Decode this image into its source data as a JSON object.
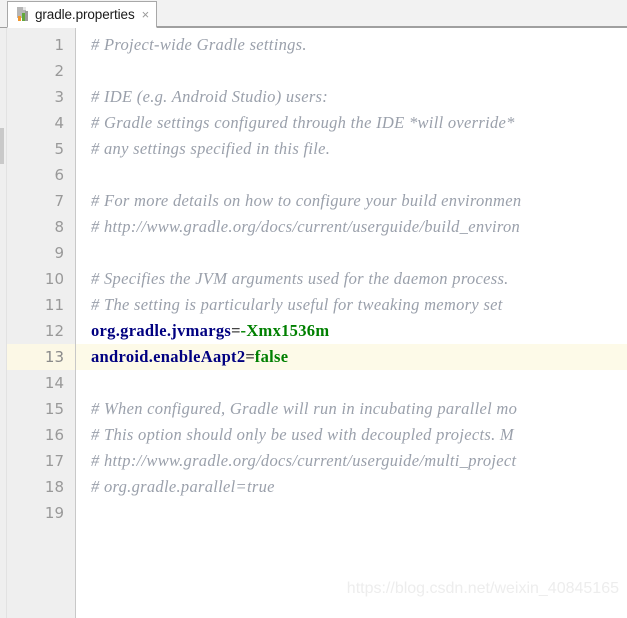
{
  "tabbar": {
    "tabs": [
      {
        "label": "gradle.properties",
        "icon": "gradle-properties-file-icon",
        "close_label": "×",
        "active": true
      }
    ]
  },
  "editor": {
    "file_name": "gradle.properties",
    "active_line": 13,
    "first_line": 1,
    "last_line": 19,
    "colors": {
      "comment": "#9aa0ab",
      "key": "#000080",
      "value": "#008000",
      "equals": "#444444",
      "gutter_bg": "#efefef",
      "gutter_fg": "#999999",
      "active_line_bg": "#fdfae8",
      "active_gutter_bg": "#fcf8e6",
      "editor_bg": "#ffffff"
    },
    "line_numbers": [
      1,
      2,
      3,
      4,
      5,
      6,
      7,
      8,
      9,
      10,
      11,
      12,
      13,
      14,
      15,
      16,
      17,
      18,
      19
    ],
    "lines": [
      {
        "n": 1,
        "type": "comment",
        "text": "# Project-wide Gradle settings."
      },
      {
        "n": 2,
        "type": "blank",
        "text": ""
      },
      {
        "n": 3,
        "type": "comment",
        "text": "# IDE (e.g. Android Studio) users:"
      },
      {
        "n": 4,
        "type": "comment",
        "text": "# Gradle settings configured through the IDE *will override*"
      },
      {
        "n": 5,
        "type": "comment",
        "text": "# any settings specified in this file."
      },
      {
        "n": 6,
        "type": "blank",
        "text": ""
      },
      {
        "n": 7,
        "type": "comment",
        "text": "# For more details on how to configure your build environmen"
      },
      {
        "n": 8,
        "type": "comment",
        "text": "# http://www.gradle.org/docs/current/userguide/build_environ"
      },
      {
        "n": 9,
        "type": "blank",
        "text": ""
      },
      {
        "n": 10,
        "type": "comment",
        "text": "# Specifies the JVM arguments used for the daemon process."
      },
      {
        "n": 11,
        "type": "comment",
        "text": "# The setting is particularly useful for tweaking memory set"
      },
      {
        "n": 12,
        "type": "property",
        "key": "org.gradle.jvmargs",
        "eq": "=",
        "value": "-Xmx1536m"
      },
      {
        "n": 13,
        "type": "property",
        "key": "android.enableAapt2",
        "eq": "=",
        "value": "false",
        "active": true
      },
      {
        "n": 14,
        "type": "blank",
        "text": ""
      },
      {
        "n": 15,
        "type": "comment",
        "text": "# When configured, Gradle will run in incubating parallel mo"
      },
      {
        "n": 16,
        "type": "comment",
        "text": "# This option should only be used with decoupled projects. M"
      },
      {
        "n": 17,
        "type": "comment",
        "text": "# http://www.gradle.org/docs/current/userguide/multi_project"
      },
      {
        "n": 18,
        "type": "comment",
        "text": "# org.gradle.parallel=true"
      },
      {
        "n": 19,
        "type": "blank",
        "text": ""
      }
    ]
  },
  "watermark": {
    "text": "https://blog.csdn.net/weixin_40845165"
  }
}
